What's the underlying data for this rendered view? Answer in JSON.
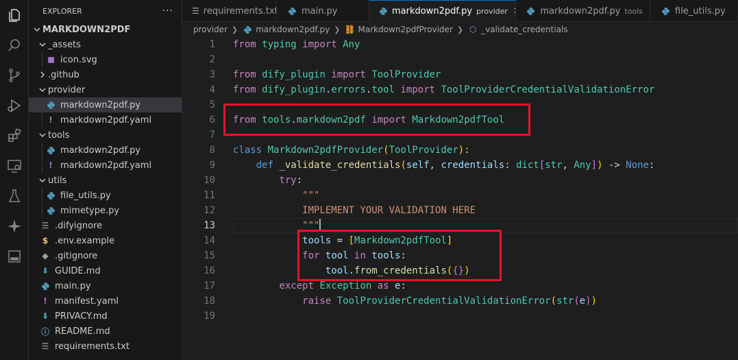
{
  "sidebar": {
    "title": "EXPLORER",
    "more": "···",
    "root": "MARKDOWN2PDF",
    "items": [
      {
        "label": "_assets"
      },
      {
        "label": "icon.svg"
      },
      {
        "label": ".github"
      },
      {
        "label": "provider"
      },
      {
        "label": "markdown2pdf.py"
      },
      {
        "label": "markdown2pdf.yaml"
      },
      {
        "label": "tools"
      },
      {
        "label": "markdown2pdf.py"
      },
      {
        "label": "markdown2pdf.yaml"
      },
      {
        "label": "utils"
      },
      {
        "label": "file_utils.py"
      },
      {
        "label": "mimetype.py"
      },
      {
        "label": ".difyignore"
      },
      {
        "label": ".env.example"
      },
      {
        "label": ".gitignore"
      },
      {
        "label": "GUIDE.md"
      },
      {
        "label": "main.py"
      },
      {
        "label": "manifest.yaml"
      },
      {
        "label": "PRIVACY.md"
      },
      {
        "label": "README.md"
      },
      {
        "label": "requirements.txt"
      }
    ]
  },
  "tabs": [
    {
      "label": "requirements.txt",
      "desc": ""
    },
    {
      "label": "main.py",
      "desc": ""
    },
    {
      "label": "markdown2pdf.py",
      "desc": "provider",
      "close": "✕"
    },
    {
      "label": "markdown2pdf.py",
      "desc": "tools"
    },
    {
      "label": "file_utils.py",
      "desc": ""
    }
  ],
  "breadcrumb": [
    "provider",
    "markdown2pdf.py",
    "Markdown2pdfProvider",
    "_validate_credentials"
  ],
  "line_numbers": [
    "1",
    "2",
    "3",
    "4",
    "5",
    "6",
    "7",
    "8",
    "9",
    "10",
    "11",
    "12",
    "13",
    "14",
    "15",
    "16",
    "17",
    "18",
    "19"
  ],
  "code": {
    "l1": [
      "from",
      "typing",
      "import",
      "Any"
    ],
    "l3": [
      "from",
      "dify_plugin",
      "import",
      "ToolProvider"
    ],
    "l4": [
      "from",
      "dify_plugin",
      ".",
      "errors",
      ".",
      "tool",
      "import",
      "ToolProviderCredentialValidationError"
    ],
    "l6": [
      "from",
      "tools",
      ".",
      "markdown2pdf",
      "import",
      "Markdown2pdfTool"
    ],
    "l8": [
      "class",
      "Markdown2pdfProvider",
      "(",
      "ToolProvider",
      "):"
    ],
    "l9": [
      "def",
      "_validate_credentials",
      "(",
      "self",
      ", ",
      "credentials",
      ": ",
      "dict",
      "[",
      "str",
      ", ",
      "Any",
      "]",
      ")",
      " -> ",
      "None",
      ":"
    ],
    "l10": [
      "try",
      ":"
    ],
    "l11": "\"\"\"",
    "l12": "IMPLEMENT YOUR VALIDATION HERE",
    "l13": "\"\"\"",
    "l14": [
      "tools",
      " = ",
      "[",
      "Markdown2pdfTool",
      "]"
    ],
    "l15": [
      "for",
      "tool",
      "in",
      "tools",
      ":"
    ],
    "l16": [
      "tool",
      ".",
      "from_credentials",
      "(",
      "{",
      "}",
      ")"
    ],
    "l17": [
      "except",
      "Exception",
      "as",
      "e",
      ":"
    ],
    "l18": [
      "raise",
      "ToolProviderCredentialValidationError",
      "(",
      "str",
      "(",
      "e",
      ")",
      ")"
    ]
  },
  "colors": {
    "accent": "#0078d4",
    "highlight_box": "#e8122b",
    "python_icon": "#519aba",
    "yaml_icon": "#a074c4"
  }
}
